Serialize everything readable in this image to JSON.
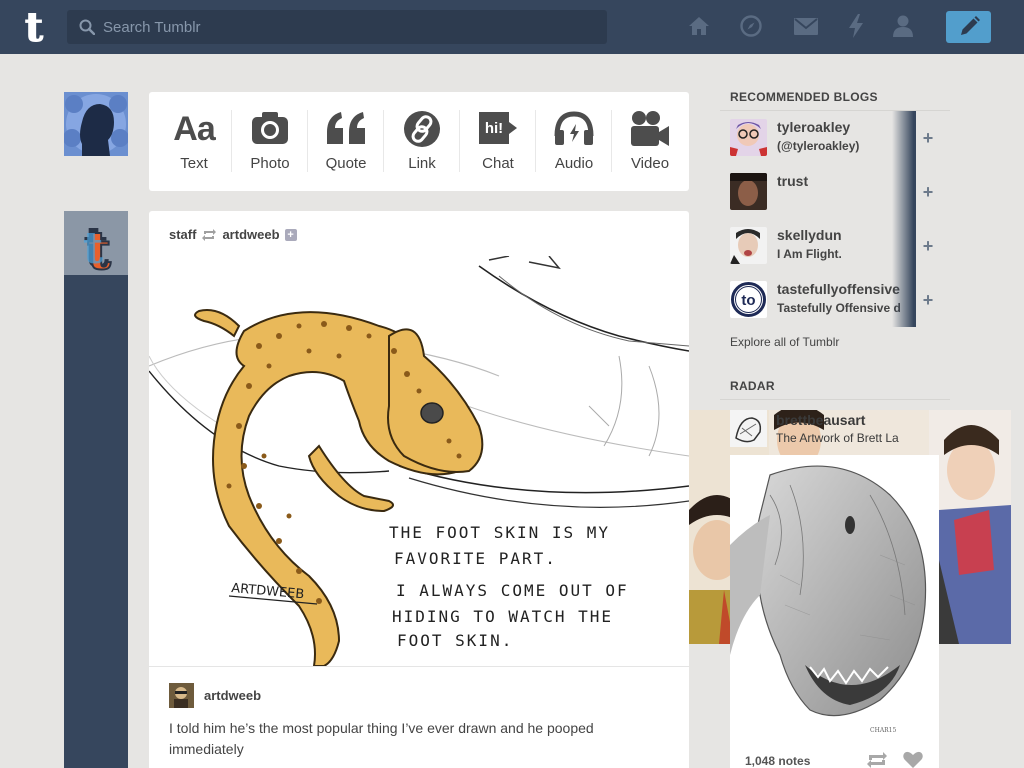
{
  "header": {
    "search_placeholder": "Search Tumblr",
    "nav": [
      "home-icon",
      "explore-icon",
      "inbox-icon",
      "activity-icon",
      "account-icon"
    ],
    "accent": "#529ecc",
    "bar_color": "#36465d"
  },
  "composer": {
    "types": [
      {
        "label": "Text",
        "icon": "text-icon"
      },
      {
        "label": "Photo",
        "icon": "camera-icon"
      },
      {
        "label": "Quote",
        "icon": "quote-icon"
      },
      {
        "label": "Link",
        "icon": "link-icon"
      },
      {
        "label": "Chat",
        "icon": "chat-icon"
      },
      {
        "label": "Audio",
        "icon": "headphones-icon"
      },
      {
        "label": "Video",
        "icon": "video-camera-icon"
      }
    ],
    "chat_glyph": "hi!"
  },
  "post": {
    "reblogger": "staff",
    "source": "artdweeb",
    "image": {
      "signature": "ARTDWEEB",
      "lines": [
        "THE FOOT SKIN IS MY",
        "FAVORITE PART.",
        "I ALWAYS COME OUT OF",
        "HIDING TO WATCH THE",
        "FOOT SKIN."
      ]
    },
    "caption_user": "artdweeb",
    "caption": "I told him he’s the most popular thing I’ve ever drawn and he pooped immediately"
  },
  "sidebar": {
    "recommended_heading": "RECOMMENDED BLOGS",
    "blogs": [
      {
        "name": "tyleroakley",
        "sub": "(@tyleroakley)"
      },
      {
        "name": "trust",
        "sub": ""
      },
      {
        "name": "skellydun",
        "sub": "I Am Flight."
      },
      {
        "name": "tastefullyoffensive",
        "sub": "Tastefully Offensive d"
      }
    ],
    "tastefully_logo": "to",
    "explore": "Explore all of Tumblr",
    "radar_heading": "RADAR",
    "radar": {
      "blog": "brettbeausart",
      "sub": "The Artwork of Brett La",
      "notes": "1,048 notes"
    }
  }
}
